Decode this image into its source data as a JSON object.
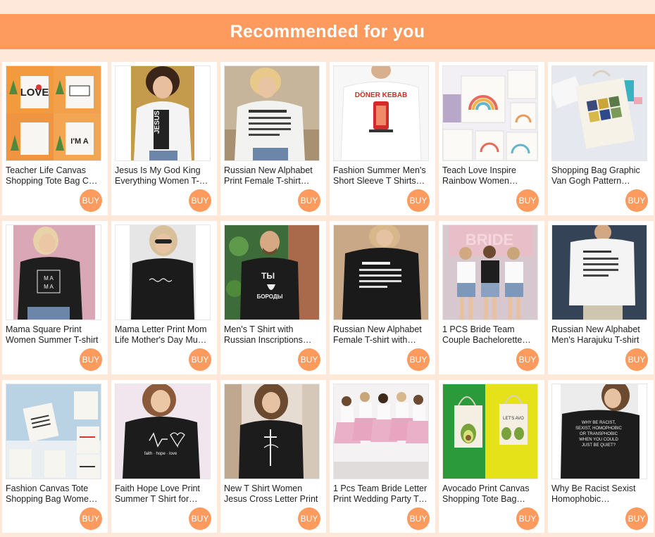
{
  "header": {
    "title": "Recommended for you"
  },
  "colors": {
    "accent": "#fd9a5e",
    "background": "#fde8da"
  },
  "products": [
    {
      "title": "Teacher Life Canvas Shopping Tote Bag Cute Women Reusable",
      "buy_label": "BUY",
      "image": "tote-bags-teacher"
    },
    {
      "title": "Jesus Is My God King Everything Women T-shirt",
      "buy_label": "BUY",
      "image": "jesus-text-tshirt"
    },
    {
      "title": "Russian New Alphabet Print Female T-shirt Summer",
      "buy_label": "BUY",
      "image": "russian-alphabet-white-tshirt"
    },
    {
      "title": "Fashion Summer Men's Short Sleeve T Shirts Doner Kebab",
      "buy_label": "BUY",
      "image": "doner-kebab-tshirt"
    },
    {
      "title": "Teach Love Inspire Rainbow Women Canvas Tote",
      "buy_label": "BUY",
      "image": "rainbow-tote-bags"
    },
    {
      "title": "Shopping Bag Graphic Van Gogh Pattern Canvas Tote",
      "buy_label": "BUY",
      "image": "van-gogh-tote"
    },
    {
      "title": "Mama Square Print Women Summer T-shirt",
      "buy_label": "BUY",
      "image": "mama-black-tshirt"
    },
    {
      "title": "Mama Letter Print Mom Life Mother's Day Mum T-shirt",
      "buy_label": "BUY",
      "image": "mama-letter-black-tshirt"
    },
    {
      "title": "Men's T Shirt with Russian Inscriptions Beard",
      "buy_label": "BUY",
      "image": "russian-beard-tshirt"
    },
    {
      "title": "Russian New Alphabet Female T-shirt with Letters",
      "buy_label": "BUY",
      "image": "russian-alphabet-black-tshirt"
    },
    {
      "title": "1 PCS Bride Team Couple Bachelorette Party T-shirt",
      "buy_label": "BUY",
      "image": "bride-team-tshirts"
    },
    {
      "title": "Russian New Alphabet Men's Harajuku T-shirt",
      "buy_label": "BUY",
      "image": "russian-alphabet-men-tshirt"
    },
    {
      "title": "Fashion Canvas Tote Shopping Bag Women Reusable",
      "buy_label": "BUY",
      "image": "canvas-tote-quotes"
    },
    {
      "title": "Faith Hope Love Print Summer T Shirt for Women",
      "buy_label": "BUY",
      "image": "faith-hope-love-tshirt"
    },
    {
      "title": "New T Shirt Women Jesus Cross Letter Print",
      "buy_label": "BUY",
      "image": "jesus-cross-tshirt"
    },
    {
      "title": "1 Pcs Team Bride Letter Print Wedding Party T-shirt",
      "buy_label": "BUY",
      "image": "team-bride-party"
    },
    {
      "title": "Avocado Print Canvas Shopping Tote Bag Women",
      "buy_label": "BUY",
      "image": "avocado-tote"
    },
    {
      "title": "Why Be Racist Sexist Homophobic Transphobic T-shirt",
      "buy_label": "BUY",
      "image": "why-be-racist-tshirt"
    }
  ]
}
